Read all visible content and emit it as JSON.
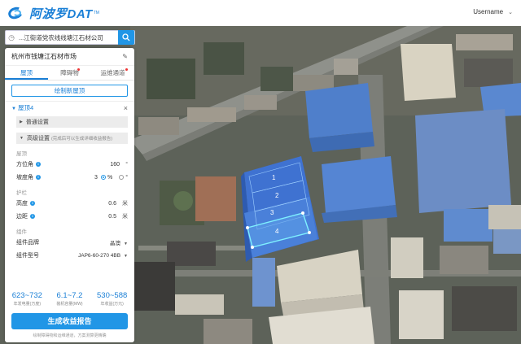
{
  "brand": {
    "name": "阿波罗DAT",
    "tm": "TM"
  },
  "user": {
    "name": "Username"
  },
  "search": {
    "value": "...江街道党农线线塘江石材公司"
  },
  "panel": {
    "title": "杭州市钱塘江石材市场",
    "tabs": [
      {
        "label": "屋顶",
        "active": true,
        "dot": false
      },
      {
        "label": "障碍物",
        "active": false,
        "dot": true
      },
      {
        "label": "运维通道",
        "active": false,
        "dot": true
      }
    ],
    "draw_label": "绘制新屋顶",
    "roof_label": "屋顶4",
    "normal_settings": "普通设置",
    "advanced_settings": "高级设置",
    "advanced_hint": "(完成后可以生成详细收益报告)",
    "group_roof": "屋顶",
    "azimuth_label": "方位角",
    "azimuth_value": "160",
    "azimuth_unit": "°",
    "slope_label": "坡度角",
    "slope_value": "3",
    "slope_pct": "%",
    "slope_deg": "°",
    "group_guard": "护栏",
    "height_label": "高度",
    "height_value": "0.6",
    "height_unit": "米",
    "margin_label": "边距",
    "margin_value": "0.5",
    "margin_unit": "米",
    "group_module": "组件",
    "brand_label": "组件品牌",
    "brand_value": "晶澳",
    "model_label": "组件型号",
    "model_value": "JAP6-60-270 4BB"
  },
  "stats": [
    {
      "num": "623~732",
      "cap": "年发电量(万度)"
    },
    {
      "num": "6.1~7.2",
      "cap": "装机容量(MW)"
    },
    {
      "num": "530~588",
      "cap": "年收益(万元)"
    }
  ],
  "generate_label": "生成收益报告",
  "footer_note": "绘制障碍物和运维通道，方案测算更精确",
  "roof_labels": [
    "1",
    "2",
    "3",
    "4"
  ],
  "colors": {
    "accent": "#2196e6",
    "brand": "#1a7fd6"
  }
}
